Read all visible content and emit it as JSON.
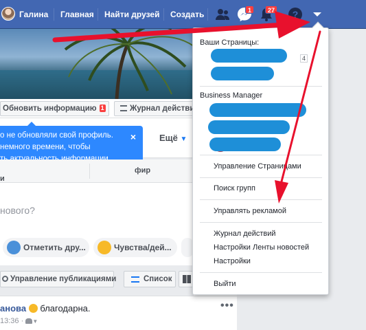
{
  "topbar": {
    "user_name": "Галина",
    "home": "Главная",
    "find_friends": "Найти друзей",
    "create": "Создать",
    "messages_badge": "1",
    "notifications_badge": "27"
  },
  "profile": {
    "update_info_button": "Обновить информацию",
    "update_info_badge": "1",
    "activity_log_button": "Журнал действий",
    "more_tab": "Ещё",
    "tooltip_line1": "о не обновляли свой профиль.",
    "tooltip_line2": "немного времени, чтобы",
    "tooltip_line3": "ть актуальность информации.",
    "composer_tab_fragment": "фир",
    "composer_tab_fragment2": "и",
    "composer_placeholder": "нового?",
    "tag_friends": "Отметить дру...",
    "feelings": "Чувства/дей...",
    "manage_posts": "Управление публикациями",
    "list_view": "Список",
    "post_author_fragment": "анова",
    "post_text": "благодарна.",
    "post_time": "13:36 ·"
  },
  "menu": {
    "your_pages_header": "Ваши Страницы:",
    "pages_count": "4",
    "business_manager_header": "Business Manager",
    "items": [
      "Управление Страницами",
      "Поиск групп",
      "Управлять рекламой",
      "Журнал действий",
      "Настройки Ленты новостей",
      "Настройки",
      "Выйти"
    ]
  },
  "colors": {
    "topbar": "#4267b2",
    "annotation_arrow": "#e8112d",
    "redaction": "#1e8fd8",
    "tooltip": "#2d88ff"
  }
}
